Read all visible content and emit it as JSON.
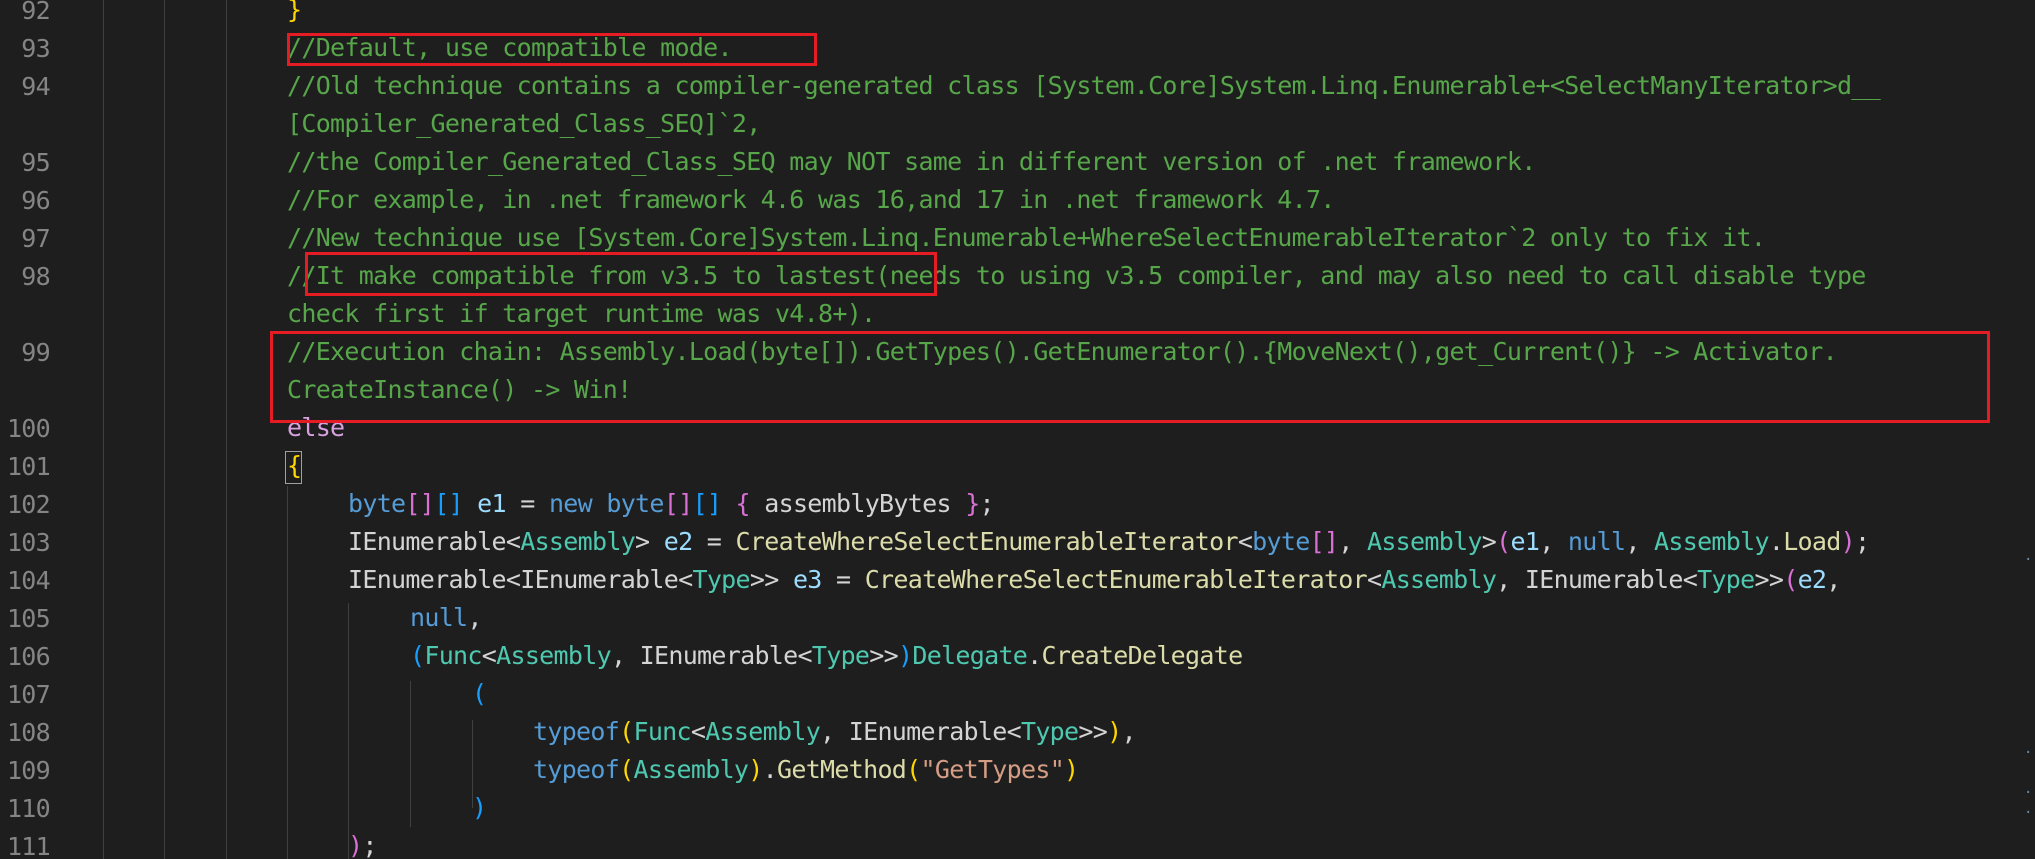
{
  "editor": {
    "line_numbers": [
      "92",
      "93",
      "94",
      "",
      "95",
      "96",
      "97",
      "98",
      "",
      "99",
      "",
      "100",
      "101",
      "102",
      "103",
      "104",
      "105",
      "106",
      "107",
      "108",
      "109",
      "110",
      "111"
    ],
    "lines": {
      "l92": "}",
      "l93": "//Default, use compatible mode.",
      "l94a": "//Old technique contains a compiler-generated class [System.Core]System.Linq.Enumerable+<SelectManyIterator>d__",
      "l94b": "[Compiler_Generated_Class_SEQ]`2,",
      "l95": "//the Compiler_Generated_Class_SEQ may NOT same in different version of .net framework.",
      "l96": "//For example, in .net framework 4.6 was 16,and 17 in .net framework 4.7.",
      "l97": "//New technique use [System.Core]System.Linq.Enumerable+WhereSelectEnumerableIterator`2 only to fix it.",
      "l98a": "//It make compatible from v3.5 to lastest(needs to using v3.5 compiler, and may also need to call disable type",
      "l98b": "check first if target runtime was v4.8+).",
      "l99a": "//Execution chain: Assembly.Load(byte[]).GetTypes().GetEnumerator().{MoveNext(),get_Current()} -> Activator.",
      "l99b": "CreateInstance() -> Win!",
      "l100": "else",
      "l101": "{"
    },
    "tokens": {
      "byte": "byte",
      "new": "new",
      "null": "null",
      "typeof": "typeof",
      "e1": "e1",
      "e2": "e2",
      "e3": "e3",
      "assemblyBytes": "assemblyBytes",
      "IEnumerable": "IEnumerable",
      "Assembly": "Assembly",
      "Type": "Type",
      "Func": "Func",
      "Delegate": "Delegate",
      "Load": "Load",
      "CreateDelegate": "CreateDelegate",
      "GetMethod": "GetMethod",
      "CreateWhereSelectEnumerableIterator": "CreateWhereSelectEnumerableIterator",
      "GetTypesStr": "\"GetTypes\""
    },
    "colors": {
      "background": "#1e1e1e",
      "comment": "#57a64a",
      "keyword": "#569cd6",
      "type": "#4ec9b0",
      "method": "#dcdcaa",
      "string": "#d69d85",
      "highlight_box": "#e51c23"
    }
  }
}
